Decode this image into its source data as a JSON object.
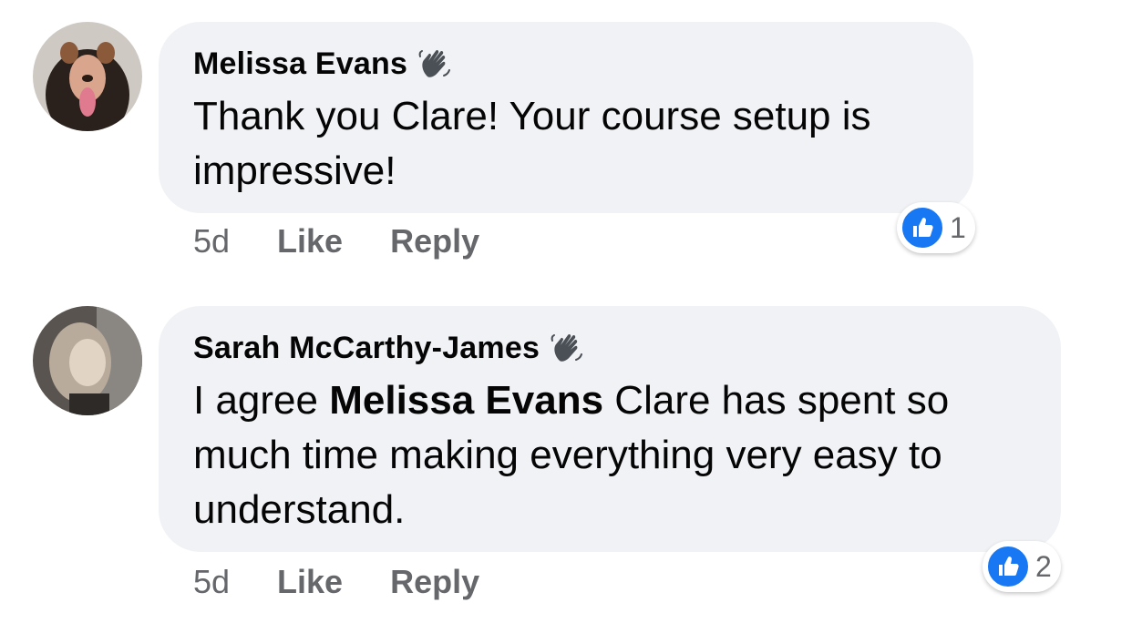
{
  "comments": [
    {
      "author": "Melissa Evans",
      "author_badge_icon": "waving-hand-icon",
      "text_parts": {
        "before": "Thank you Clare! Your course setup is impressive!",
        "mention": "",
        "after": ""
      },
      "time": "5d",
      "like_label": "Like",
      "reply_label": "Reply",
      "reaction_icon": "thumbs-up-icon",
      "reaction_count": "1"
    },
    {
      "author": "Sarah McCarthy-James",
      "author_badge_icon": "waving-hand-icon",
      "text_parts": {
        "before": "I agree ",
        "mention": "Melissa Evans",
        "after": " Clare has spent so much time making everything very easy to understand."
      },
      "time": "5d",
      "like_label": "Like",
      "reply_label": "Reply",
      "reaction_icon": "thumbs-up-icon",
      "reaction_count": "2"
    }
  ],
  "colors": {
    "bubble": "#f0f2f5",
    "text": "#050505",
    "secondary_text": "#65676b",
    "like_blue": "#1877f2"
  }
}
